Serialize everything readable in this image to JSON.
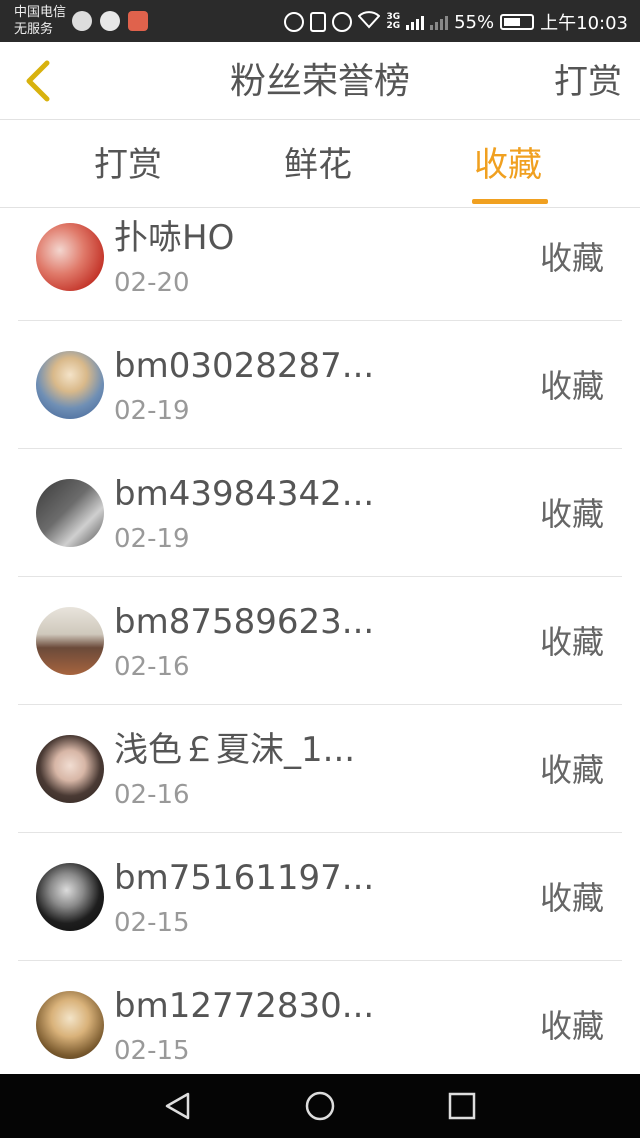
{
  "status_bar": {
    "carrier": "中国电信",
    "service": "无服务",
    "net_top": "3G",
    "net_bottom": "2G",
    "battery": "55%",
    "time": "上午10:03"
  },
  "header": {
    "title": "粉丝荣誉榜",
    "right_action": "打赏"
  },
  "tabs": [
    {
      "label": "打赏",
      "active": false
    },
    {
      "label": "鲜花",
      "active": false
    },
    {
      "label": "收藏",
      "active": true
    }
  ],
  "colors": {
    "accent": "#f0a020",
    "text": "#555555",
    "subtext": "#999999"
  },
  "fans": [
    {
      "name": "扑哧HO",
      "date": "02-20",
      "action": "收藏"
    },
    {
      "name": "bm03028287...",
      "date": "02-19",
      "action": "收藏"
    },
    {
      "name": "bm43984342...",
      "date": "02-19",
      "action": "收藏"
    },
    {
      "name": "bm87589623...",
      "date": "02-16",
      "action": "收藏"
    },
    {
      "name": "浅色￡夏沫_1...",
      "date": "02-16",
      "action": "收藏"
    },
    {
      "name": "bm75161197...",
      "date": "02-15",
      "action": "收藏"
    },
    {
      "name": "bm12772830...",
      "date": "02-15",
      "action": "收藏"
    }
  ],
  "nav_icons": [
    "back-triangle-icon",
    "home-circle-icon",
    "recents-square-icon"
  ]
}
